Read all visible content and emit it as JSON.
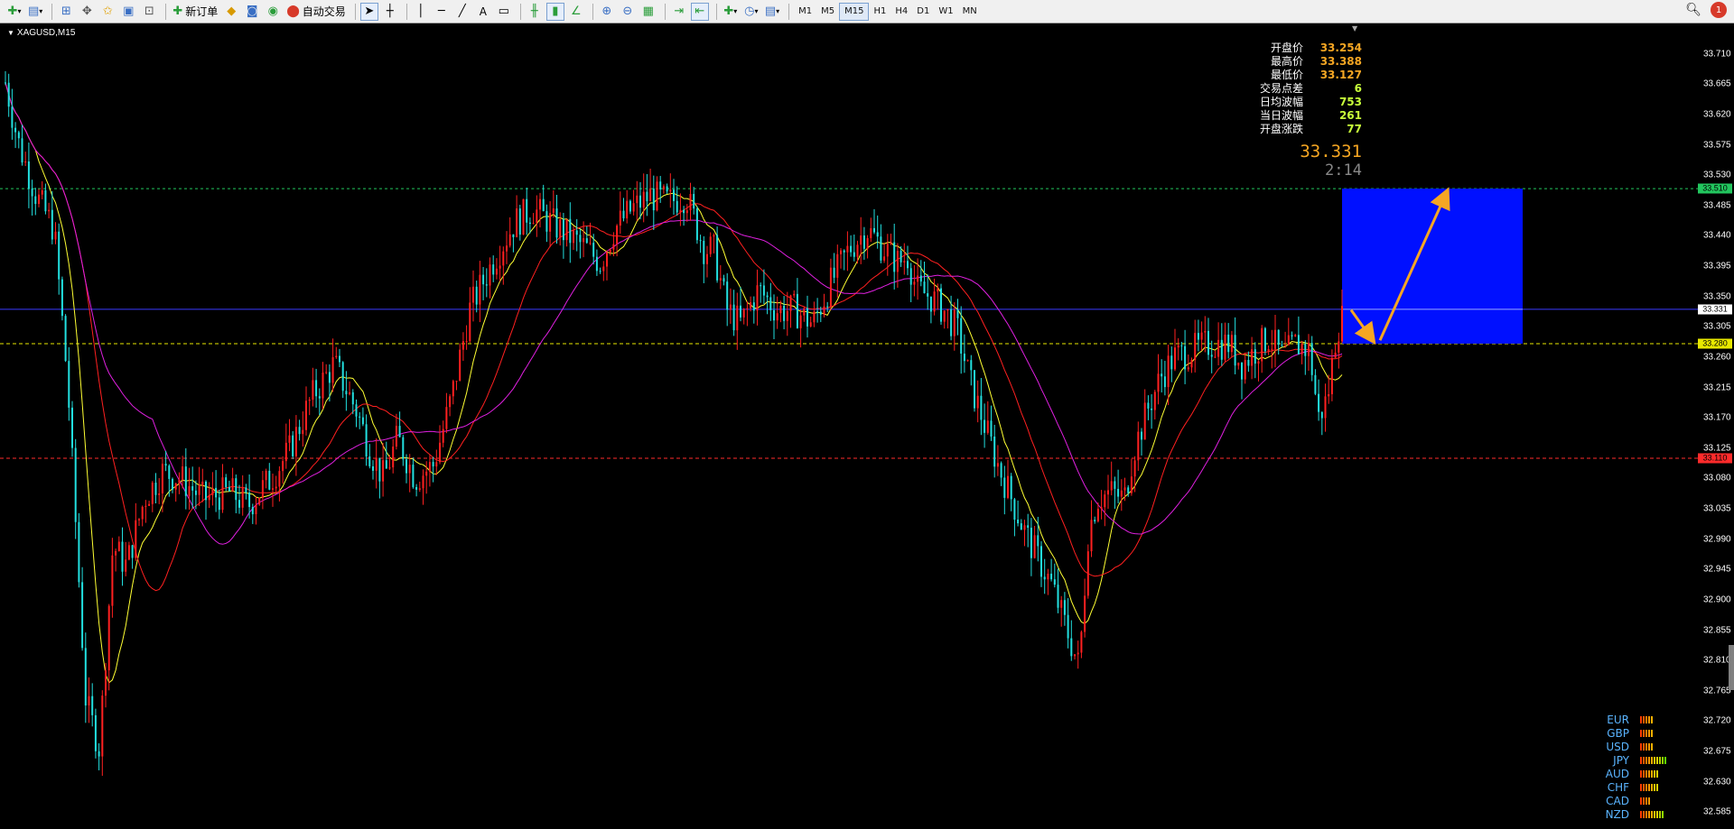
{
  "toolbar": {
    "new_order": "新订单",
    "auto_trade": "自动交易",
    "timeframes": [
      "M1",
      "M5",
      "M15",
      "H1",
      "H4",
      "D1",
      "W1",
      "MN"
    ],
    "active_timeframe": "M15",
    "notification_count": "1"
  },
  "chart": {
    "symbol": "XAGUSD,M15",
    "current_price": "33.331",
    "countdown": "2:14",
    "price_range": [
      32.56,
      33.755
    ],
    "axis_ticks": [
      "33.710",
      "33.665",
      "33.620",
      "33.575",
      "33.530",
      "33.485",
      "33.440",
      "33.395",
      "33.350",
      "33.305",
      "33.260",
      "33.215",
      "33.170",
      "33.125",
      "33.080",
      "33.035",
      "32.990",
      "32.945",
      "32.900",
      "32.855",
      "32.810",
      "32.765",
      "32.720",
      "32.675",
      "32.630",
      "32.585"
    ],
    "tags": {
      "resistance": "33.510",
      "current": "33.331",
      "support": "33.280",
      "low_line": "33.110"
    },
    "lines": {
      "resistance": 33.51,
      "current": 33.331,
      "support": 33.28,
      "low_line": 33.11
    },
    "colors": {
      "resistance_line": "#22c55e",
      "current_line": "#3b3bff",
      "support_line": "#e8e800",
      "low_line": "#ff2b2b",
      "bull_candle": "#ff2020",
      "bear_candle": "#22e0e0",
      "zone": "#0010ff",
      "arrow": "#f5a623"
    },
    "zone": {
      "top": 33.51,
      "bottom": 33.28
    }
  },
  "info_panel": [
    {
      "label": "开盘价",
      "value": "33.254",
      "color": "#f5a623"
    },
    {
      "label": "最高价",
      "value": "33.388",
      "color": "#f5a623"
    },
    {
      "label": "最低价",
      "value": "33.127",
      "color": "#f5a623"
    },
    {
      "label": "交易点差",
      "value": "6",
      "color": "#c8ff3a"
    },
    {
      "label": "日均波幅",
      "value": "753",
      "color": "#c8ff3a"
    },
    {
      "label": "当日波幅",
      "value": "261",
      "color": "#c8ff3a"
    },
    {
      "label": "开盘涨跌",
      "value": "77",
      "color": "#c8ff3a"
    }
  ],
  "currency_strength": [
    {
      "name": "EUR",
      "bars": 5
    },
    {
      "name": "GBP",
      "bars": 5
    },
    {
      "name": "USD",
      "bars": 5
    },
    {
      "name": "JPY",
      "bars": 10
    },
    {
      "name": "AUD",
      "bars": 7
    },
    {
      "name": "CHF",
      "bars": 7
    },
    {
      "name": "CAD",
      "bars": 4
    },
    {
      "name": "NZD",
      "bars": 9
    }
  ]
}
